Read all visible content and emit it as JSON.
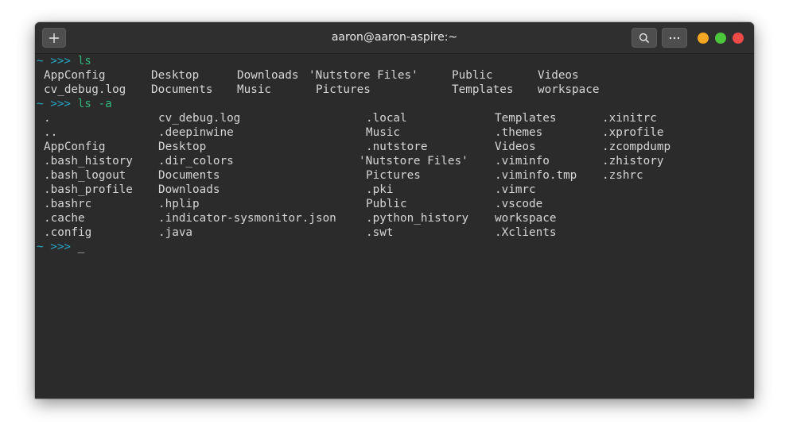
{
  "window": {
    "title": "aaron@aaron-aspire:~"
  },
  "colors": {
    "prompt": "#26a6c9",
    "command": "#32b57a",
    "text": "#d6d6d6",
    "background": "#2b2b2b",
    "minimize": "#f5a623",
    "maximize": "#4cc73b",
    "close": "#f04b4b"
  },
  "icons": {
    "new_tab": "plus-icon",
    "search": "search-icon",
    "menu": "ellipsis-icon"
  },
  "prompt": "~ >>>",
  "commands": {
    "first": "ls",
    "second": "ls -a",
    "cursor": "_"
  },
  "ls": [
    [
      "AppConfig",
      "Desktop",
      "Downloads",
      "'Nutstore Files'",
      "Public",
      "Videos"
    ],
    [
      "cv_debug.log",
      "Documents",
      "Music",
      "Pictures",
      "Templates",
      "workspace"
    ]
  ],
  "ls_a": [
    [
      ".",
      "cv_debug.log",
      ".local",
      "Templates",
      ".xinitrc"
    ],
    [
      "..",
      ".deepinwine",
      "Music",
      ".themes",
      ".xprofile"
    ],
    [
      "AppConfig",
      "Desktop",
      ".nutstore",
      "Videos",
      ".zcompdump"
    ],
    [
      ".bash_history",
      ".dir_colors",
      "'Nutstore Files'",
      ".viminfo",
      ".zhistory"
    ],
    [
      ".bash_logout",
      "Documents",
      "Pictures",
      ".viminfo.tmp",
      ".zshrc"
    ],
    [
      ".bash_profile",
      "Downloads",
      ".pki",
      ".vimrc",
      ""
    ],
    [
      ".bashrc",
      ".hplip",
      "Public",
      ".vscode",
      ""
    ],
    [
      ".cache",
      ".indicator-sysmonitor.json",
      ".python_history",
      "workspace",
      ""
    ],
    [
      ".config",
      ".java",
      ".swt",
      ".Xclients",
      ""
    ]
  ]
}
